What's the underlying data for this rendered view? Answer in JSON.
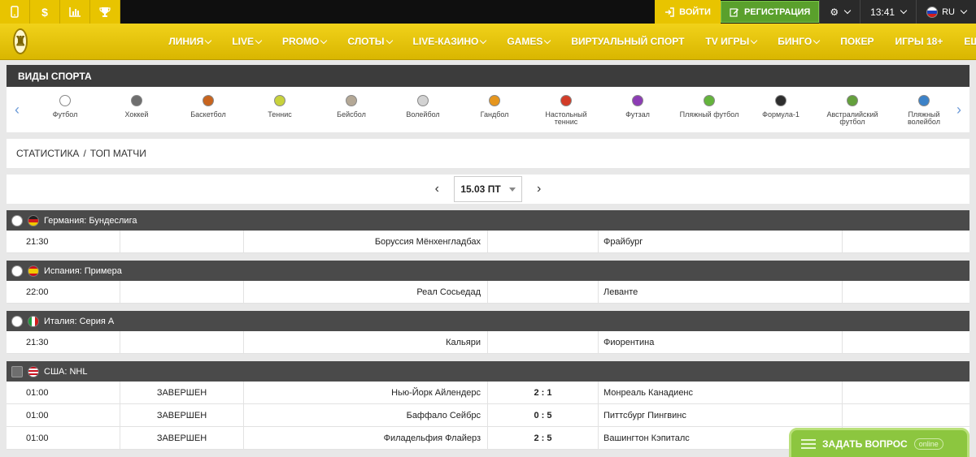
{
  "topbar": {
    "utility_icons": [
      "mobile-icon",
      "dollar-icon",
      "chart-icon",
      "trophy-icon"
    ],
    "dollar_glyph": "$",
    "login_label": "ВОЙТИ",
    "register_label": "РЕГИСТРАЦИЯ",
    "time": "13:41",
    "language": "RU"
  },
  "nav": {
    "items": [
      {
        "label": "ЛИНИЯ",
        "dropdown": true
      },
      {
        "label": "LIVE",
        "dropdown": true
      },
      {
        "label": "PROMO",
        "dropdown": true
      },
      {
        "label": "СЛОТЫ",
        "dropdown": true
      },
      {
        "label": "LIVE-КАЗИНО",
        "dropdown": true
      },
      {
        "label": "GAMES",
        "dropdown": true
      },
      {
        "label": "ВИРТУАЛЬНЫЙ СПОРТ",
        "dropdown": false
      },
      {
        "label": "TV ИГРЫ",
        "dropdown": true
      },
      {
        "label": "БИНГО",
        "dropdown": true
      },
      {
        "label": "ПОКЕР",
        "dropdown": false
      },
      {
        "label": "ИГРЫ 18+",
        "dropdown": false
      },
      {
        "label": "ЕЩЁ",
        "dropdown": true
      }
    ]
  },
  "sports": {
    "title": "ВИДЫ СПОРТА",
    "items": [
      {
        "label": "Футбол",
        "color": "#ffffff"
      },
      {
        "label": "Хоккей",
        "color": "#6e6e6e"
      },
      {
        "label": "Баскетбол",
        "color": "#c8641e"
      },
      {
        "label": "Теннис",
        "color": "#c8d23c"
      },
      {
        "label": "Бейсбол",
        "color": "#b4a896"
      },
      {
        "label": "Волейбол",
        "color": "#d2d2d2"
      },
      {
        "label": "Гандбол",
        "color": "#e6961e"
      },
      {
        "label": "Настольный теннис",
        "color": "#d23c28"
      },
      {
        "label": "Футзал",
        "color": "#8c3cb4"
      },
      {
        "label": "Пляжный футбол",
        "color": "#64b43c"
      },
      {
        "label": "Формула-1",
        "color": "#2d2d2d"
      },
      {
        "label": "Австралийский футбол",
        "color": "#64a03c"
      },
      {
        "label": "Пляжный волейбол",
        "color": "#3c82c8"
      }
    ]
  },
  "breadcrumb": {
    "stats": "СТАТИСТИКА",
    "separator": "/",
    "top": "ТОП МАТЧИ"
  },
  "date_nav": {
    "current": "15.03 ПТ"
  },
  "leagues": [
    {
      "name": "Германия: Бундеслига",
      "sport_icon": "football-icon",
      "flag": "de",
      "matches": [
        {
          "time": "21:30",
          "status": "",
          "home": "Боруссия Мёнхенгладбах",
          "score": "",
          "away": "Фрайбург"
        }
      ]
    },
    {
      "name": "Испания: Примера",
      "sport_icon": "football-icon",
      "flag": "es",
      "matches": [
        {
          "time": "22:00",
          "status": "",
          "home": "Реал Сосьедад",
          "score": "",
          "away": "Леванте"
        }
      ]
    },
    {
      "name": "Италия: Серия А",
      "sport_icon": "football-icon",
      "flag": "it",
      "matches": [
        {
          "time": "21:30",
          "status": "",
          "home": "Кальяри",
          "score": "",
          "away": "Фиорентина"
        }
      ]
    },
    {
      "name": "США: NHL",
      "sport_icon": "hockey-icon",
      "flag": "us",
      "matches": [
        {
          "time": "01:00",
          "status": "ЗАВЕРШЕН",
          "home": "Нью-Йорк Айлендерс",
          "score": "2 : 1",
          "away": "Монреаль Канадиенс"
        },
        {
          "time": "01:00",
          "status": "ЗАВЕРШЕН",
          "home": "Баффало Сейбрс",
          "score": "0 : 5",
          "away": "Питтсбург Пингвинс"
        },
        {
          "time": "01:00",
          "status": "ЗАВЕРШЕН",
          "home": "Филадельфия Флайерз",
          "score": "2 : 5",
          "away": "Вашингтон Кэпиталс"
        }
      ]
    }
  ],
  "chat": {
    "label": "ЗАДАТЬ ВОПРОС",
    "status": "online"
  },
  "colors": {
    "accent": "#e8c400",
    "register": "#5aa02c",
    "chat": "#8cc63f",
    "header_dark": "#3c3c3c"
  }
}
